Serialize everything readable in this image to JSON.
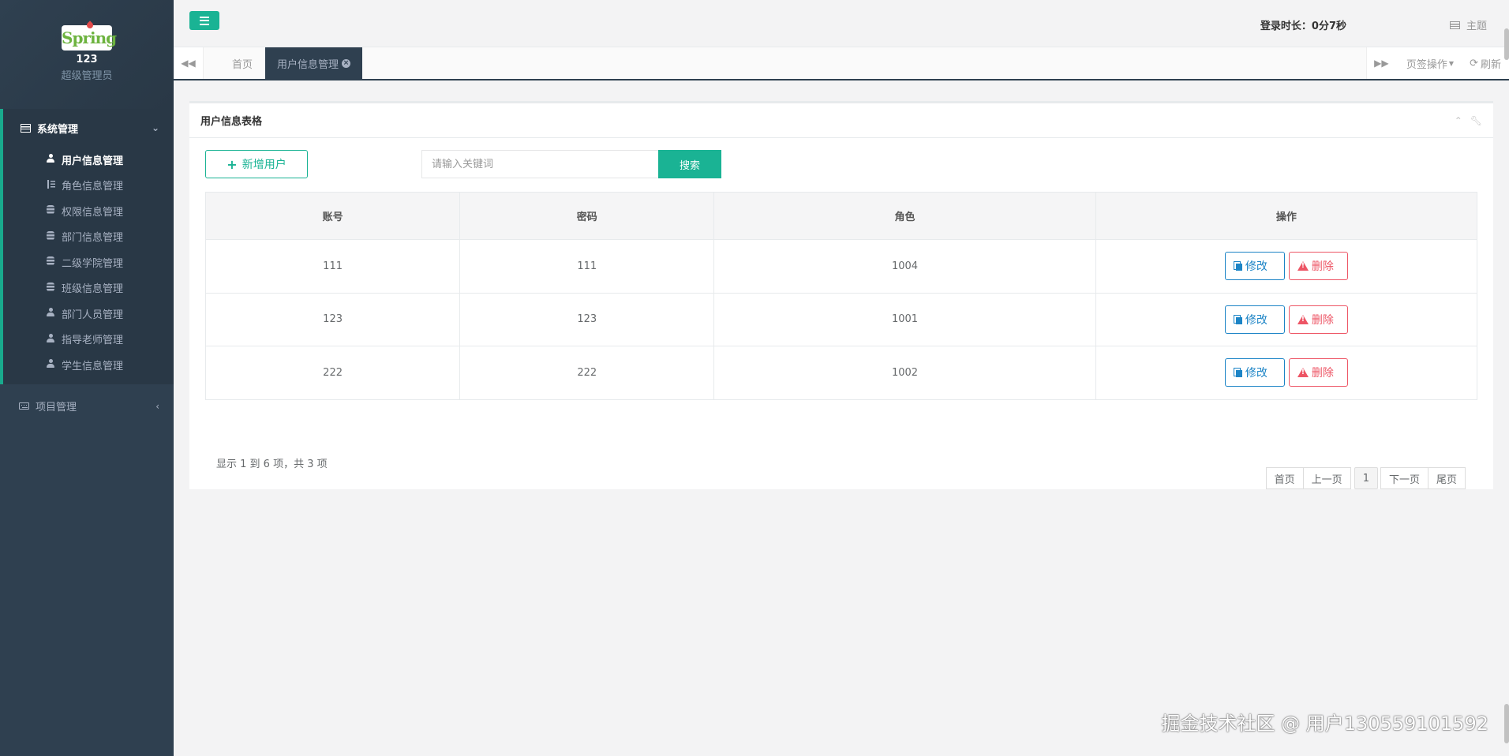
{
  "profile": {
    "logo_text": "Spring",
    "username": "123",
    "role": "超级管理员"
  },
  "menu": {
    "system": {
      "label": "系统管理",
      "items": [
        {
          "label": "用户信息管理",
          "icon": "user-icon"
        },
        {
          "label": "角色信息管理",
          "icon": "sort-icon"
        },
        {
          "label": "权限信息管理",
          "icon": "database-icon"
        },
        {
          "label": "部门信息管理",
          "icon": "database-icon"
        },
        {
          "label": "二级学院管理",
          "icon": "database-icon"
        },
        {
          "label": "班级信息管理",
          "icon": "database-icon"
        },
        {
          "label": "部门人员管理",
          "icon": "user-icon"
        },
        {
          "label": "指导老师管理",
          "icon": "user-icon"
        },
        {
          "label": "学生信息管理",
          "icon": "user-icon"
        }
      ]
    },
    "project": {
      "label": "项目管理"
    }
  },
  "header": {
    "login_time": "登录时长：0分7秒",
    "theme": "主题"
  },
  "tabs": {
    "home": "首页",
    "active": "用户信息管理",
    "page_ops": "页签操作",
    "refresh": "刷新"
  },
  "panel": {
    "title": "用户信息表格",
    "add_button": "新增用户",
    "search_placeholder": "请输入关键词",
    "search_button": "搜索"
  },
  "table": {
    "headers": [
      "账号",
      "密码",
      "角色",
      "操作"
    ],
    "rows": [
      {
        "account": "111",
        "password": "111",
        "role": "1004"
      },
      {
        "account": "123",
        "password": "123",
        "role": "1001"
      },
      {
        "account": "222",
        "password": "222",
        "role": "1002"
      }
    ],
    "edit_label": "修改",
    "delete_label": "删除"
  },
  "pagination": {
    "info": "显示 1 到 6 项，共 3 项",
    "first": "首页",
    "prev": "上一页",
    "current": "1",
    "next": "下一页",
    "last": "尾页"
  },
  "watermark": "掘金技术社区 @ 用户130559101592",
  "colors": {
    "sidebar": "#2f4050",
    "accent": "#1ab394",
    "edit": "#1c84c6",
    "delete": "#ed5565"
  }
}
